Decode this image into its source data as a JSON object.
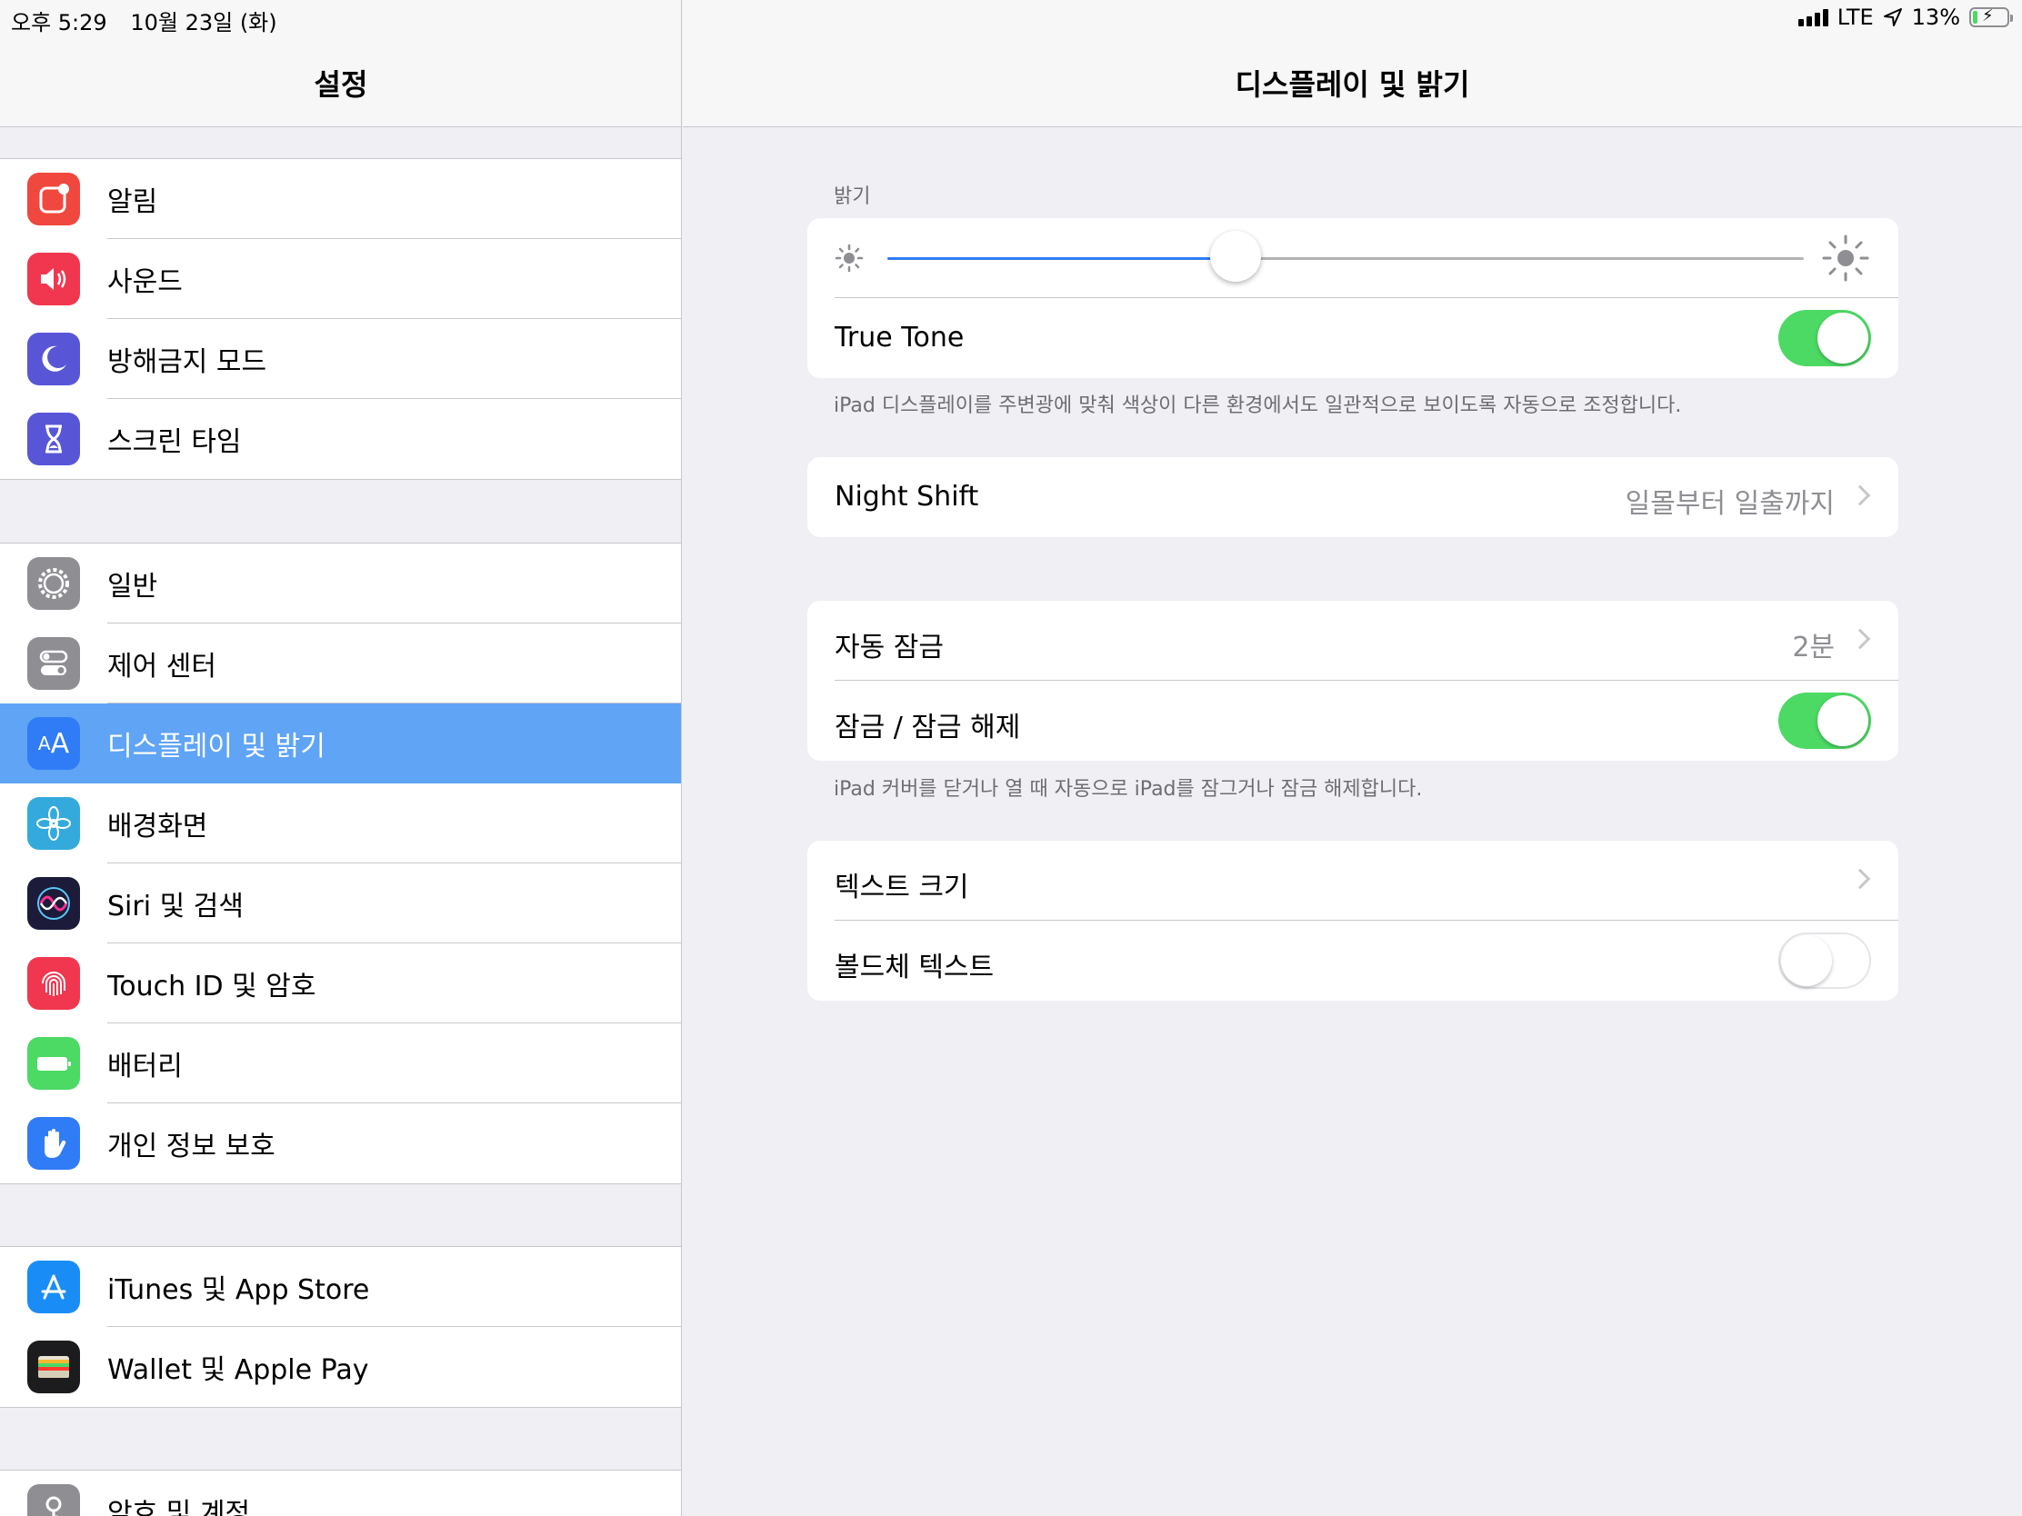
{
  "status_bar": {
    "time": "오후 5:29",
    "date": "10월 23일 (화)",
    "network": "LTE",
    "battery_percent": "13%",
    "battery_level": 0.13
  },
  "left": {
    "title": "설정",
    "groups": [
      [
        {
          "label": "알림",
          "icon": "notifications-icon",
          "color": "#f0483e"
        },
        {
          "label": "사운드",
          "icon": "speaker-icon",
          "color": "#f0374f"
        },
        {
          "label": "방해금지 모드",
          "icon": "moon-icon",
          "color": "#5856d6"
        },
        {
          "label": "스크린 타임",
          "icon": "hourglass-icon",
          "color": "#5856d6"
        }
      ],
      [
        {
          "label": "일반",
          "icon": "gear-icon",
          "color": "#8e8e93"
        },
        {
          "label": "제어 센터",
          "icon": "switches-icon",
          "color": "#8e8e93"
        },
        {
          "label": "디스플레이 및 밝기",
          "icon": "text-size-icon",
          "color": "#2f7cf6",
          "selected": true
        },
        {
          "label": "배경화면",
          "icon": "flower-icon",
          "color": "#34aadc"
        },
        {
          "label": "Siri 및 검색",
          "icon": "siri-icon",
          "color": "#1c1c3a"
        },
        {
          "label": "Touch ID 및 암호",
          "icon": "fingerprint-icon",
          "color": "#f0374f"
        },
        {
          "label": "배터리",
          "icon": "battery-icon",
          "color": "#4cd964"
        },
        {
          "label": "개인 정보 보호",
          "icon": "hand-icon",
          "color": "#2f7cf6"
        }
      ],
      [
        {
          "label": "iTunes 및 App Store",
          "icon": "app-store-icon",
          "color": "#1a8cf5"
        },
        {
          "label": "Wallet 및 Apple Pay",
          "icon": "wallet-icon",
          "color": "#1c1c1e"
        }
      ],
      [
        {
          "label": "암호 및 계정",
          "icon": "key-icon",
          "color": "#8e8e93"
        }
      ]
    ]
  },
  "right": {
    "title": "디스플레이 및 밝기",
    "brightness_label": "밝기",
    "brightness_value": 0.38,
    "true_tone_label": "True Tone",
    "true_tone_on": true,
    "true_tone_footer": "iPad 디스플레이를 주변광에 맞춰 색상이 다른 환경에서도 일관적으로 보이도록 자동으로 조정합니다.",
    "night_shift_label": "Night Shift",
    "night_shift_value": "일몰부터 일출까지",
    "auto_lock_label": "자동 잠금",
    "auto_lock_value": "2분",
    "lock_unlock_label": "잠금 / 잠금 해제",
    "lock_unlock_on": true,
    "lock_unlock_footer": "iPad 커버를 닫거나 열 때 자동으로 iPad를 잠그거나 잠금 해제합니다.",
    "text_size_label": "텍스트 크기",
    "bold_text_label": "볼드체 텍스트",
    "bold_text_on": false
  }
}
